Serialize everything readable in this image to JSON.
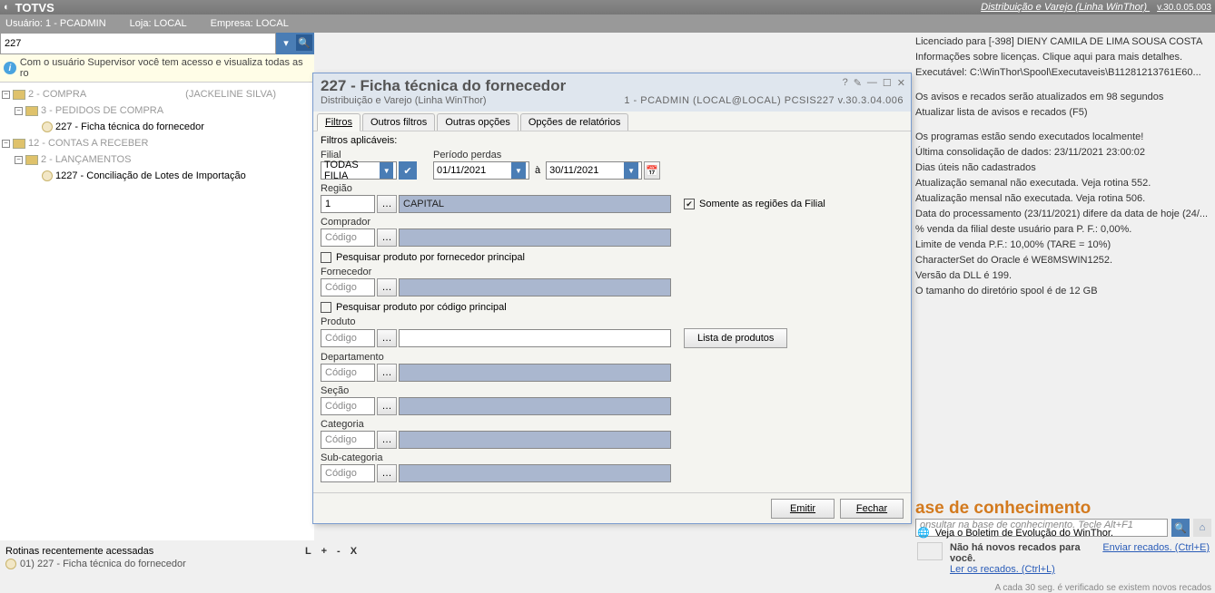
{
  "topbar": {
    "logo": "TOTVS",
    "module": "Distribuição e Varejo (Linha WinThor)",
    "version": "v.30.0.05.003"
  },
  "userbar": {
    "user": "Usuário: 1 - PCADMIN",
    "loja": "Loja: LOCAL",
    "empresa": "Empresa: LOCAL"
  },
  "left": {
    "search_value": "227",
    "info": "Com o usuário Supervisor você tem acesso e visualiza todas as ro",
    "tree": [
      {
        "label": "2 - COMPRA",
        "extra": "(JACKELINE SILVA)"
      },
      {
        "label": "3 - PEDIDOS DE COMPRA"
      },
      {
        "label": "227 - Ficha técnica do fornecedor"
      },
      {
        "label": "12 - CONTAS A RECEBER"
      },
      {
        "label": "2 - LANÇAMENTOS"
      },
      {
        "label": "1227 - Conciliação de Lotes de Importação"
      }
    ]
  },
  "dialog": {
    "title": "227 - Ficha técnica do fornecedor",
    "subtitle": "Distribuição e Varejo (Linha WinThor)",
    "subright": "1 - PCADMIN (LOCAL@LOCAL)   PCSIS227   v.30.3.04.006",
    "tabs": [
      "Filtros",
      "Outros filtros",
      "Outras opções",
      "Opções de relatórios"
    ],
    "applied": "Filtros aplicáveis:",
    "labels": {
      "filial": "Filial",
      "periodo": "Período perdas",
      "a": "à",
      "regiao": "Região",
      "comprador": "Comprador",
      "pesq_forn": "Pesquisar produto por fornecedor principal",
      "fornecedor": "Fornecedor",
      "pesq_cod": "Pesquisar produto por código principal",
      "produto": "Produto",
      "lista": "Lista de produtos",
      "departamento": "Departamento",
      "secao": "Seção",
      "categoria": "Categoria",
      "subcategoria": "Sub-categoria",
      "somente": "Somente as regiões da Filial",
      "codigo_ph": "Código"
    },
    "values": {
      "filial": "TODAS FILIA",
      "data1": "01/11/2021",
      "data2": "30/11/2021",
      "regiao_code": "1",
      "regiao_name": "CAPITAL"
    },
    "buttons": {
      "emitir": "Emitir",
      "fechar": "Fechar"
    }
  },
  "messages": [
    "Licenciado para [-398] DIENY CAMILA DE LIMA SOUSA COSTA",
    "Informações sobre licenças. Clique aqui para mais detalhes.",
    "Executável: C:\\WinThor\\Spool\\Executaveis\\B11281213761E60...",
    "Os avisos e recados serão atualizados em 98 segundos",
    "Atualizar lista de avisos e recados (F5)",
    "Os programas estão sendo executados localmente!",
    "Última consolidação de dados: 23/11/2021 23:00:02",
    "Dias úteis não cadastrados",
    "Atualização semanal não executada. Veja rotina 552.",
    "Atualização mensal não executada. Veja rotina 506.",
    "Data do processamento (23/11/2021) difere da data de hoje (24/...",
    "% venda da filial deste usuário para P. F.: 0,00%.",
    "Limite de venda P.F.: 10,00% (TARE = 10%)",
    "CharacterSet do Oracle é WE8MSWIN1252.",
    "Versão da DLL é 199.",
    "O tamanho do diretório spool é de 12 GB"
  ],
  "kb": {
    "title": "ase de conhecimento",
    "placeholder": "onsultar na base de conhecimento. Tecle Alt+F1"
  },
  "boletim": "Veja o Boletim de Evolução do WinThor.",
  "recados": {
    "bold": "Não há novos recados para você.",
    "ler": "Ler os recados. (Ctrl+L)",
    "enviar": "Enviar recados. (Ctrl+E)"
  },
  "recent": {
    "title": "Rotinas recentemente acessadas",
    "item": "01)  227 - Ficha técnica do fornecedor"
  },
  "footer_keys": "L   +   -    X",
  "tinyfoot": "A cada 30 seg. é verificado se existem novos recados"
}
